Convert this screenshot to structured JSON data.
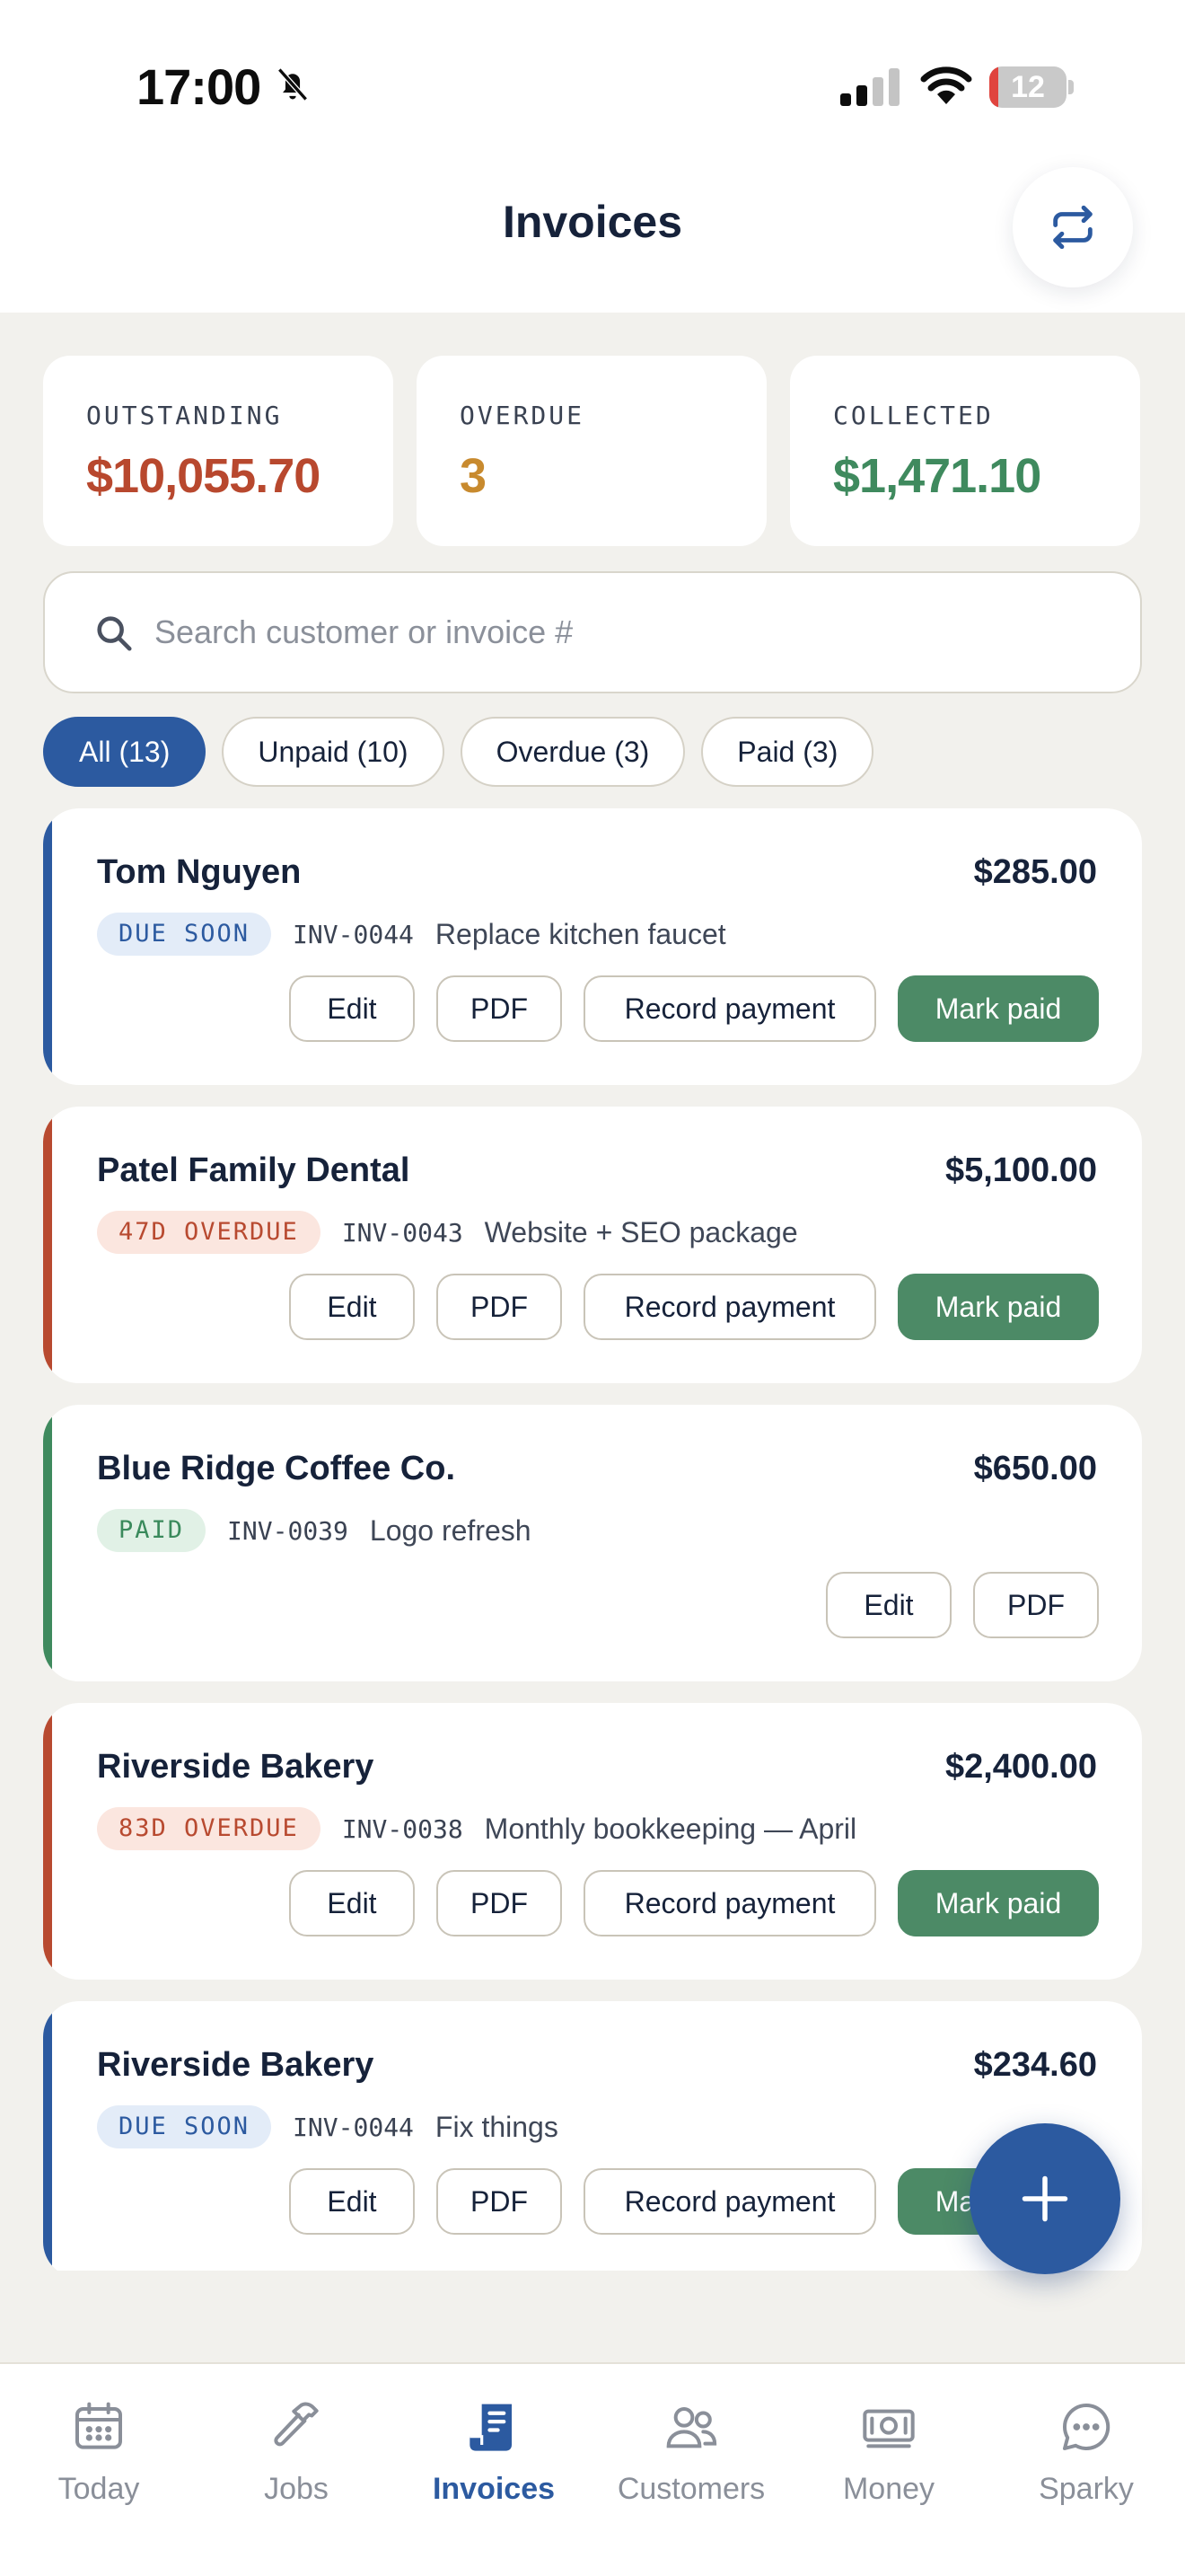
{
  "status_bar": {
    "time": "17:00",
    "battery": "12",
    "battery_level": 0.12
  },
  "header": {
    "title": "Invoices"
  },
  "stats": [
    {
      "label": "OUTSTANDING",
      "value": "$10,055.70",
      "color": "#b8482e"
    },
    {
      "label": "OVERDUE",
      "value": "3",
      "color": "#c88a2e"
    },
    {
      "label": "COLLECTED",
      "value": "$1,471.10",
      "color": "#3f8a5e"
    }
  ],
  "search": {
    "placeholder": "Search customer or invoice #",
    "value": ""
  },
  "filters": [
    {
      "label": "All (13)",
      "active": true
    },
    {
      "label": "Unpaid (10)",
      "active": false
    },
    {
      "label": "Overdue (3)",
      "active": false
    },
    {
      "label": "Paid (3)",
      "active": false
    }
  ],
  "actions": {
    "edit": "Edit",
    "pdf": "PDF",
    "record": "Record payment",
    "mark_paid": "Mark paid"
  },
  "invoices": [
    {
      "customer": "Tom Nguyen",
      "amount": "$285.00",
      "status": "DUE SOON",
      "status_type": "due",
      "number": "INV-0044",
      "description": "Replace kitchen faucet",
      "stripe": "#2c5aa0"
    },
    {
      "customer": "Patel Family Dental",
      "amount": "$5,100.00",
      "status": "47D OVERDUE",
      "status_type": "overdue",
      "number": "INV-0043",
      "description": "Website + SEO package",
      "stripe": "#b84a30"
    },
    {
      "customer": "Blue Ridge Coffee Co.",
      "amount": "$650.00",
      "status": "PAID",
      "status_type": "paid",
      "number": "INV-0039",
      "description": "Logo refresh",
      "stripe": "#3f8a5e"
    },
    {
      "customer": "Riverside Bakery",
      "amount": "$2,400.00",
      "status": "83D OVERDUE",
      "status_type": "overdue",
      "number": "INV-0038",
      "description": "Monthly bookkeeping — April",
      "stripe": "#b84a30"
    },
    {
      "customer": "Riverside Bakery",
      "amount": "$234.60",
      "status": "DUE SOON",
      "status_type": "due",
      "number": "INV-0044",
      "description": "Fix things",
      "stripe": "#2c5aa0"
    }
  ],
  "tabs": [
    {
      "label": "Today",
      "icon": "calendar-icon",
      "active": false
    },
    {
      "label": "Jobs",
      "icon": "hammer-icon",
      "active": false
    },
    {
      "label": "Invoices",
      "icon": "receipt-icon",
      "active": true
    },
    {
      "label": "Customers",
      "icon": "people-icon",
      "active": false
    },
    {
      "label": "Money",
      "icon": "banknote-icon",
      "active": false
    },
    {
      "label": "Sparky",
      "icon": "chat-bubble-icon",
      "active": false
    }
  ],
  "colors": {
    "accent": "#2c5aa0",
    "success": "#4c8a66",
    "danger": "#b84a30",
    "warning": "#c88a2e"
  }
}
